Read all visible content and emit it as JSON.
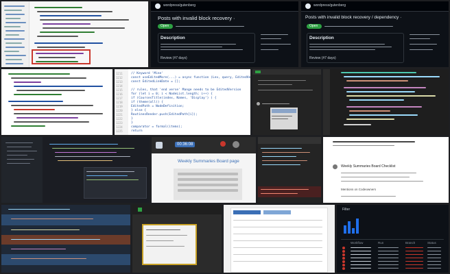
{
  "colors": {
    "page_bg": "#1e1f22",
    "github_dark": "#0d1117",
    "github_green": "#2ea043",
    "editor_dark": "#1e1e1e",
    "code_red_highlight": "#c9372c",
    "keyword_purple": "#7a3e9d",
    "string_green": "#2e7d32",
    "code_blue": "#1f4fa0",
    "wp_blue": "#3b6fb6"
  },
  "tiles": {
    "pr_dark_1": {
      "repo_line": "wordpress/gutenberg",
      "title": "Posts with invalid block recovery ·",
      "badge": "Open",
      "section": "Description",
      "footer_label": "Review (#7 days)"
    },
    "pr_dark_2": {
      "repo_line": "wordpress/gutenberg",
      "title": "Posts with invalid block recovery / dependency ·",
      "badge": "Open",
      "section": "Description",
      "footer_label": "Review (#7 days)"
    },
    "code_light": {
      "gutter_start": "1211",
      "lines": [
        "// Keyword 'Mine'",
        "const useEditedMore(...) = async function (Lev, query, EditedVersion) {",
        "  const  EditedLinkDate = [];",
        "",
        "  // rules, that 'end verse' Mange needs to be EditedVersion",
        "  for (let i = 0; i < NodeList.length; i++) {",
        "    if (CoursesTitle(index, Names, 'Display') ) {",
        "      if (theme(all)) {",
        "        EditedPath = NodeDefinition;",
        "      } else {",
        "        RoutinesRender.push(EditedPath[i]);",
        "      }",
        "    }",
        "    comparator = formal(items);",
        "    return"
      ]
    },
    "meeting": {
      "time": "00:36:08",
      "heading": "Weekly Summaries Board page"
    },
    "issue_card": {
      "title": "Weekly Summaries Board Checklist",
      "comment_label": "Mentions on Codeowners"
    },
    "actions": {
      "header": "Filter",
      "columns": [
        "Workflow",
        "Run",
        "Branch",
        "Status"
      ],
      "rows": 7
    }
  }
}
